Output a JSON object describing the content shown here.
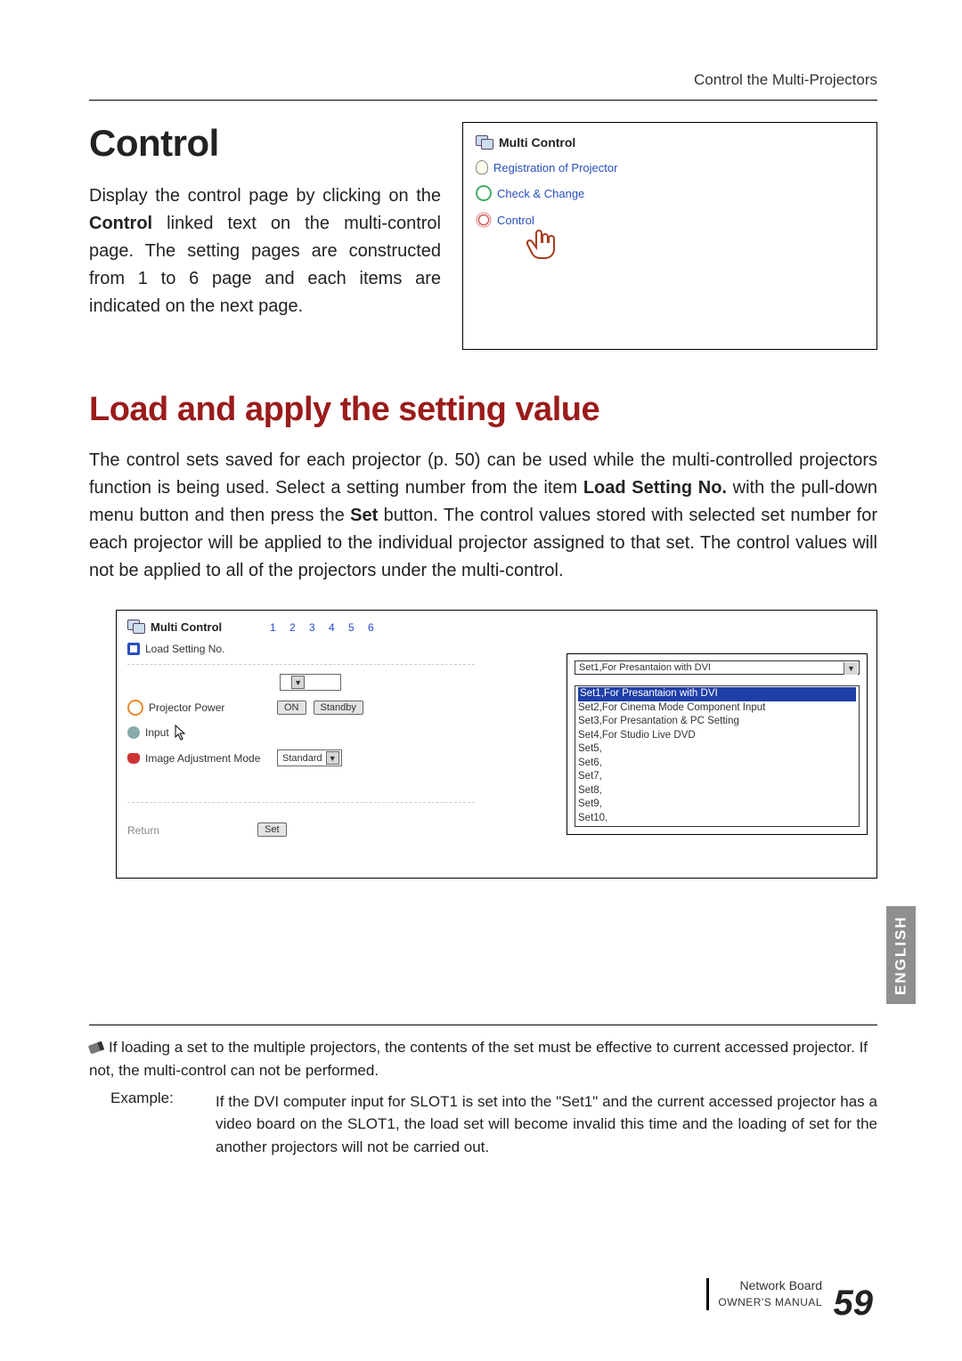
{
  "header": {
    "breadcrumb": "Control the Multi-Projectors"
  },
  "section1": {
    "heading": "Control",
    "p_before_bold": "Display the control page by clicking on the ",
    "p_bold": "Control",
    "p_after_bold": " linked text on the multi-control page. The setting pages are constructed from 1 to 6 page and each items are indicated on the next page."
  },
  "panel": {
    "title": "Multi Control",
    "links": {
      "registration": "Registration of Projector",
      "check_change": "Check & Change",
      "control": "Control"
    }
  },
  "section2": {
    "heading": "Load and apply the setting value",
    "p1": "The control sets saved for each projector (p. 50) can be used while the multi-controlled projectors function is being used. Select a setting number from the item ",
    "p1_bold1": "Load Setting No.",
    "p1_mid": " with the pull-down menu button and then press the ",
    "p1_bold2": "Set",
    "p1_after": " button. The control values stored with selected set number for each projector will be applied to the individual projector assigned to that set. The control values will not be applied to all of the projectors under the multi-control."
  },
  "screenshot": {
    "title": "Multi Control",
    "pages": "1 2 3 4 5 6",
    "load_label": "Load Setting No.",
    "power_label": "Projector Power",
    "power_on": "ON",
    "power_standby": "Standby",
    "input_label": "Input",
    "img_mode_label": "Image Adjustment Mode",
    "img_mode_value": "Standard",
    "return": "Return",
    "set_btn": "Set",
    "dropdown_current": "Set1,For Presantaion with DVI",
    "options": [
      "Set1,For Presantaion with DVI",
      "Set2,For Cinema Mode Component Input",
      "Set3,For Presantation & PC Setting",
      "Set4,For Studio Live DVD",
      "Set5,",
      "Set6,",
      "Set7,",
      "Set8,",
      "Set9,",
      "Set10,"
    ]
  },
  "side_tab": "ENGLISH",
  "footnote": {
    "line1": "If loading a set to the multiple projectors, the contents of the set must be effective to current accessed projector. If not, the multi-control  can not be performed.",
    "example_label": "Example:",
    "example_body": "If the DVI computer input for SLOT1 is set into the \"Set1\" and the current accessed projector has a video board on the SLOT1, the load set will become invalid this time and the loading of set for the another projectors will not be carried out."
  },
  "footer": {
    "line1": "Network Board",
    "owner": "OWNER'S MANUAL",
    "page_num": "59"
  }
}
